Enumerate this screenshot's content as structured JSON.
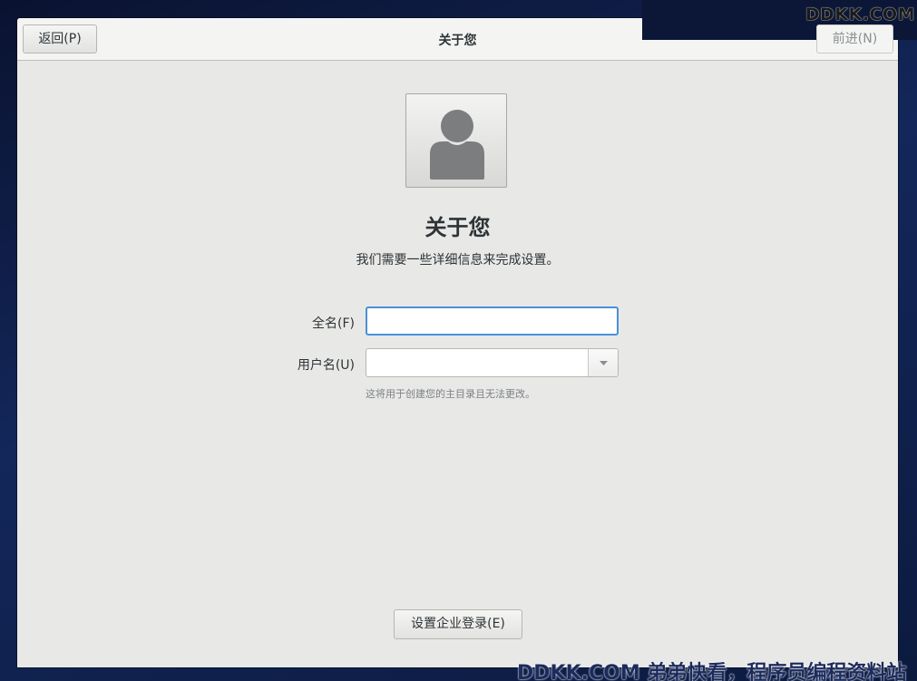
{
  "header": {
    "back_label": "返回(P)",
    "title": "关于您",
    "next_label": "前进(N)"
  },
  "main": {
    "title": "关于您",
    "subtitle": "我们需要一些详细信息来完成设置。",
    "fullname": {
      "label": "全名(F)",
      "value": ""
    },
    "username": {
      "label": "用户名(U)",
      "value": "",
      "hint": "这将用于创建您的主目录且无法更改。"
    },
    "enterprise_login_label": "设置企业登录(E)"
  },
  "watermarks": {
    "top_right": "DDKK.COM",
    "bottom": "DDKK.COM 弟弟快看，程序员编程资料站"
  },
  "icons": {
    "avatar": "user-silhouette-icon",
    "dropdown": "chevron-down-icon"
  },
  "colors": {
    "focus_border": "#4a90d9",
    "window_bg": "#e8e8e7",
    "desktop_bg": "#0b1634"
  }
}
